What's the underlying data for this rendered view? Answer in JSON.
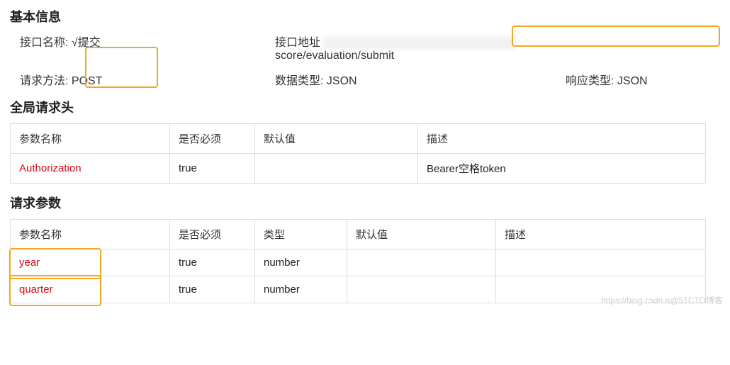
{
  "basic_info": {
    "heading": "基本信息",
    "labels": {
      "name": "接口名称:",
      "url": "接口地址",
      "method": "请求方法:",
      "data_type": "数据类型:",
      "response_type": "响应类型:"
    },
    "values": {
      "name": "√提交",
      "url_visible_suffix": "score/evaluation/submit",
      "method": "POST",
      "data_type": "JSON",
      "response_type": "JSON"
    }
  },
  "global_headers": {
    "heading": "全局请求头",
    "columns": {
      "name": "参数名称",
      "required": "是否必须",
      "default": "默认值",
      "description": "描述"
    },
    "rows": [
      {
        "name": "Authorization",
        "required": "true",
        "default": "",
        "description": "Bearer空格token"
      }
    ]
  },
  "request_params": {
    "heading": "请求参数",
    "columns": {
      "name": "参数名称",
      "required": "是否必须",
      "type": "类型",
      "default": "默认值",
      "description": "描述"
    },
    "rows": [
      {
        "name": "year",
        "required": "true",
        "type": "number",
        "default": "",
        "description": ""
      },
      {
        "name": "quarter",
        "required": "true",
        "type": "number",
        "default": "",
        "description": ""
      }
    ]
  },
  "watermark": "https://blog.csdn.n@51CTO博客"
}
